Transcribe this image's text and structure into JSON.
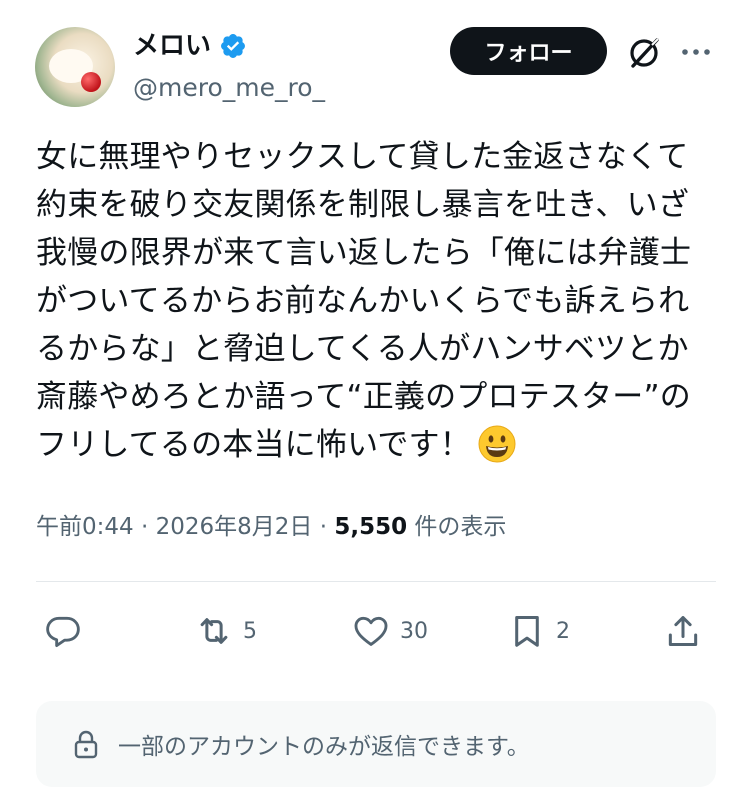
{
  "user": {
    "display_name": "メロい",
    "handle": "@mero_me_ro_",
    "verified_color": "#1d9bf0"
  },
  "header": {
    "follow_label": "フォロー",
    "icons": [
      "grok-icon",
      "more-icon"
    ]
  },
  "tweet": {
    "text": "女に無理やりセックスして貸した金返さなくて\n約束を破り交友関係を制限し暴言を吐き、いざ\n我慢の限界が来て言い返したら「俺には弁護士\nがついてるからお前なんかいくらでも訴えられ\nるからな」と脅迫してくる人がハンサベツとか\n斎藤やめろとか語って“正義のプロテスター”の\nフリしてるの本当に怖いです！",
    "emoji": "grinning-face-emoji"
  },
  "meta": {
    "time": "午前0:44",
    "date": "2026年8月2日",
    "separator": " · ",
    "views_count": "5,550",
    "views_label": " 件の表示"
  },
  "actions": {
    "reply_count": "",
    "retweet_count": "5",
    "like_count": "30",
    "bookmark_count": "2"
  },
  "reply_restriction": {
    "text": "一部のアカウントのみが返信できます。"
  },
  "colors": {
    "text": "#0f1419",
    "secondary": "#536471",
    "accent": "#1d9bf0",
    "divider": "#e4e8eb",
    "notice_bg": "#f7f9f9"
  }
}
